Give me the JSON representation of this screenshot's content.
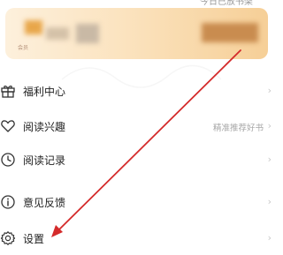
{
  "top_hint": "今日已放书架",
  "banner": {
    "caption": "会员",
    "background_colors": [
      "#fdf0dc",
      "#f6cf97"
    ]
  },
  "menu": {
    "items": [
      {
        "label": "福利中心",
        "icon": "gift-icon",
        "extra": ""
      },
      {
        "label": "阅读兴趣",
        "icon": "heart-icon",
        "extra": "精准推荐好书"
      },
      {
        "label": "阅读记录",
        "icon": "clock-icon",
        "extra": ""
      },
      {
        "label": "意见反馈",
        "icon": "info-icon",
        "extra": ""
      },
      {
        "label": "设置",
        "icon": "gear-icon",
        "extra": ""
      }
    ],
    "chevron": "›"
  },
  "annotation": {
    "arrow_color": "#d42b2b",
    "description_target": "设置"
  }
}
